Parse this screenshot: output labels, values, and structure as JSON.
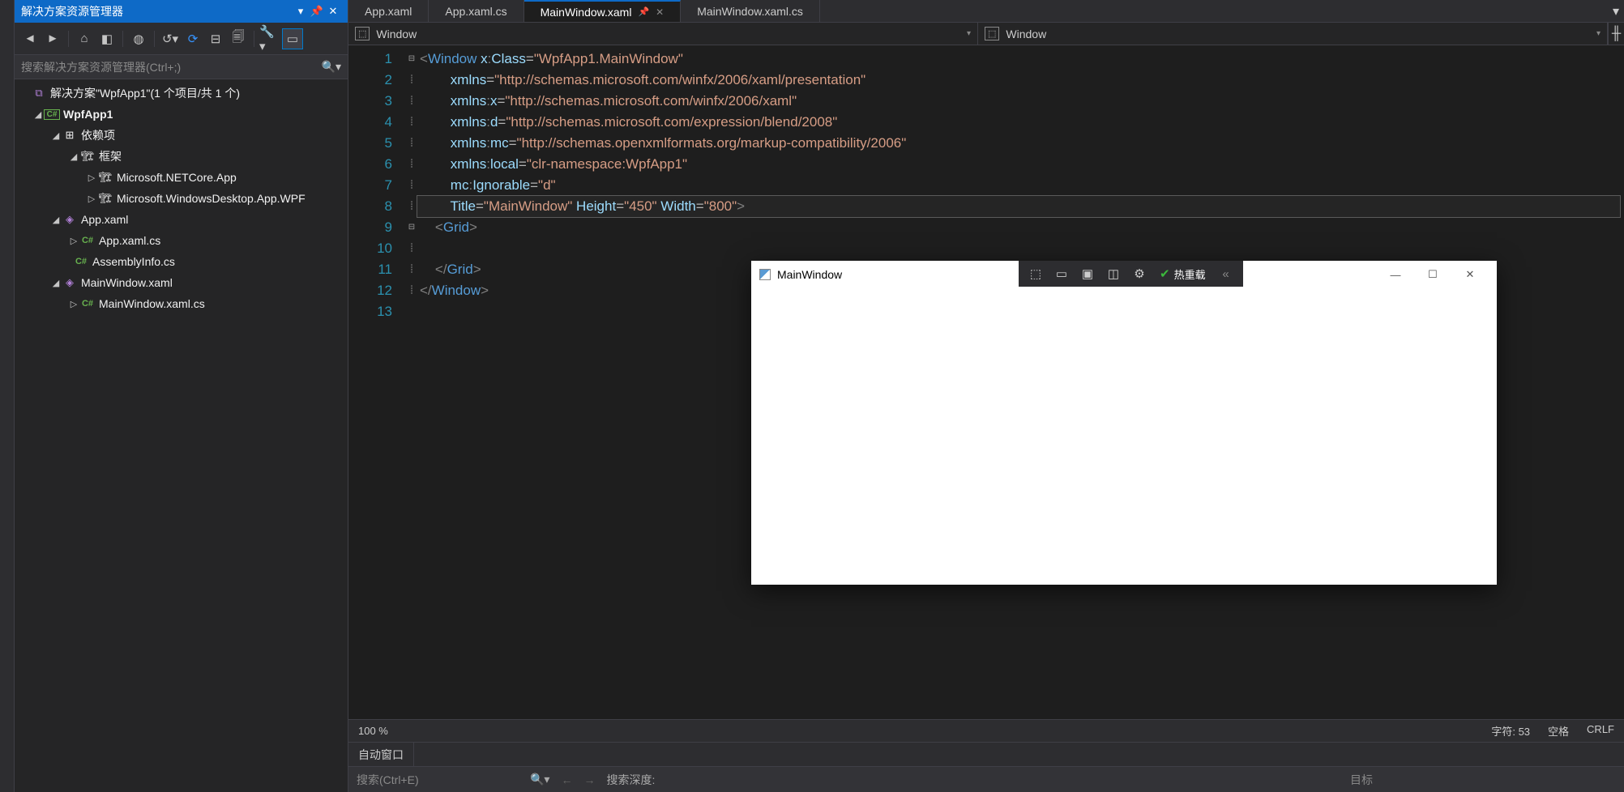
{
  "explorer": {
    "title": "解决方案资源管理器",
    "search_placeholder": "搜索解决方案资源管理器(Ctrl+;)",
    "nodes": {
      "solution": "解决方案\"WpfApp1\"(1 个项目/共 1 个)",
      "project": "WpfApp1",
      "deps": "依赖项",
      "frame": "框架",
      "netcore": "Microsoft.NETCore.App",
      "wpfdesk": "Microsoft.WindowsDesktop.App.WPF",
      "appxaml": "App.xaml",
      "appxamlcs": "App.xaml.cs",
      "assembly": "AssemblyInfo.cs",
      "mainxaml": "MainWindow.xaml",
      "mainxamlcs": "MainWindow.xaml.cs"
    }
  },
  "tabs": {
    "t1": "App.xaml",
    "t2": "App.xaml.cs",
    "t3": "MainWindow.xaml",
    "t4": "MainWindow.xaml.cs"
  },
  "nav": {
    "left": "Window",
    "right": "Window"
  },
  "code": {
    "lines": {
      "l1": "1",
      "l2": "2",
      "l3": "3",
      "l4": "4",
      "l5": "5",
      "l6": "6",
      "l7": "7",
      "l8": "8",
      "l9": "9",
      "l10": "10",
      "l11": "11",
      "l12": "12",
      "l13": "13"
    }
  },
  "status": {
    "zoom": "100 %",
    "chars_label": "字符:",
    "chars_val": "53",
    "ws": "空格",
    "eol": "CRLF"
  },
  "bottom": {
    "auto": "自动窗口",
    "search_placeholder": "搜索(Ctrl+E)",
    "depth_label": "搜索深度:",
    "target": "目标"
  },
  "appwin": {
    "title": "MainWindow",
    "hot": "热重载"
  }
}
